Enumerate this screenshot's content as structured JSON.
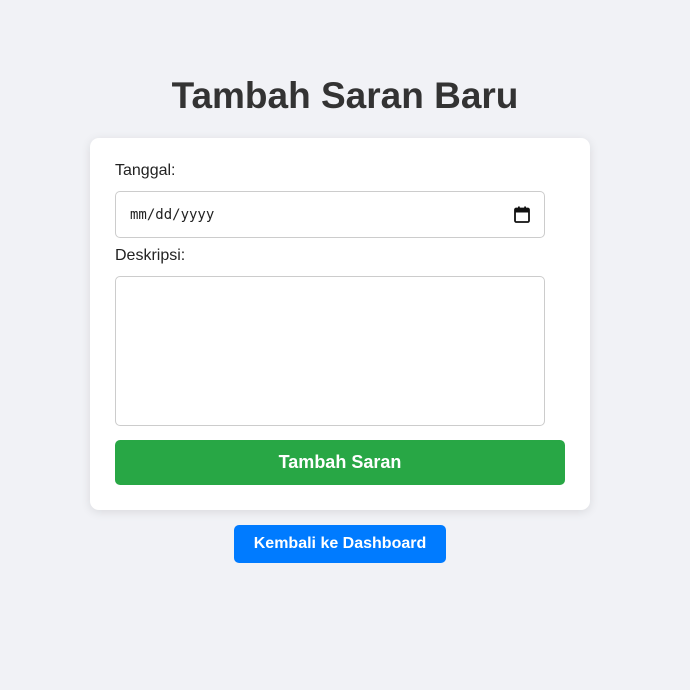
{
  "page": {
    "title": "Tambah Saran Baru"
  },
  "form": {
    "date_label": "Tanggal:",
    "date_placeholder": "mm/dd/yyyy",
    "date_value": "",
    "description_label": "Deskripsi:",
    "description_value": "",
    "submit_label": "Tambah Saran"
  },
  "nav": {
    "back_label": "Kembali ke Dashboard"
  },
  "icons": {
    "date_picker": "calendar-icon"
  },
  "colors": {
    "background": "#f1f2f6",
    "submit": "#28a745",
    "back": "#007bff",
    "title": "#333333"
  }
}
